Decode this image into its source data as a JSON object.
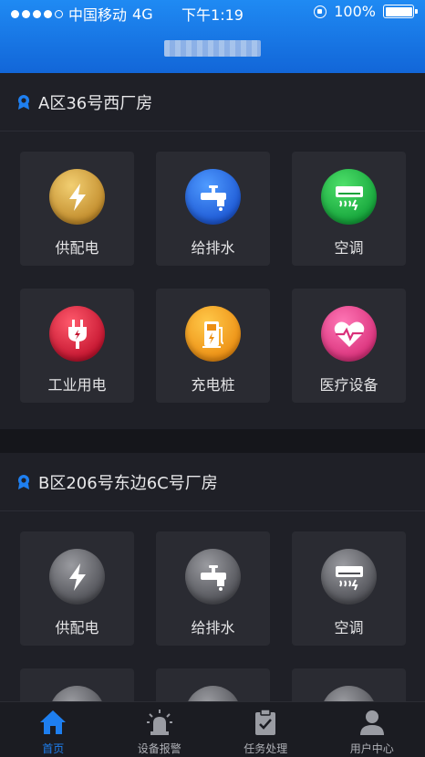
{
  "status_bar": {
    "carrier": "中国移动",
    "network": "4G",
    "time": "下午1:19",
    "battery": "100%"
  },
  "sections": [
    {
      "title": "A区36号西厂房",
      "tiles": [
        {
          "label": "供配电",
          "icon": "lightning-icon",
          "color": "gold"
        },
        {
          "label": "给排水",
          "icon": "faucet-icon",
          "color": "blue"
        },
        {
          "label": "空调",
          "icon": "air-conditioner-icon",
          "color": "green"
        },
        {
          "label": "工业用电",
          "icon": "plug-icon",
          "color": "red"
        },
        {
          "label": "充电桩",
          "icon": "charging-station-icon",
          "color": "orange"
        },
        {
          "label": "医疗设备",
          "icon": "heart-pulse-icon",
          "color": "pink"
        }
      ]
    },
    {
      "title": "B区206号东边6C号厂房",
      "tiles": [
        {
          "label": "供配电",
          "icon": "lightning-icon",
          "color": "gray"
        },
        {
          "label": "给排水",
          "icon": "faucet-icon",
          "color": "gray"
        },
        {
          "label": "空调",
          "icon": "air-conditioner-icon",
          "color": "gray"
        }
      ]
    }
  ],
  "tab_bar": [
    {
      "label": "首页",
      "icon": "home-icon",
      "active": true
    },
    {
      "label": "设备报警",
      "icon": "alarm-light-icon",
      "active": false
    },
    {
      "label": "任务处理",
      "icon": "clipboard-check-icon",
      "active": false
    },
    {
      "label": "用户中心",
      "icon": "user-icon",
      "active": false
    }
  ],
  "colors": {
    "header_blue": "#1f8af3",
    "tab_active": "#1e7ff0",
    "background": "#15161b"
  }
}
